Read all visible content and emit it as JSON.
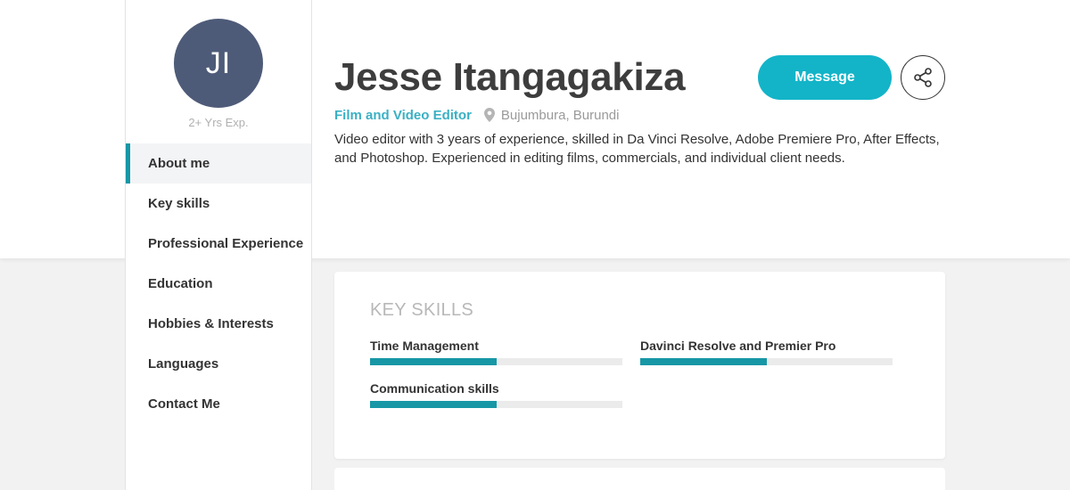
{
  "profile": {
    "initials": "JI",
    "experience": "2+ Yrs Exp.",
    "name": "Jesse Itangagakiza",
    "role": "Film and Video Editor",
    "location": "Bujumbura, Burundi",
    "bio": "Video editor with 3 years of experience, skilled in Da Vinci Resolve, Adobe Premiere Pro, After Effects, and Photoshop. Experienced in editing films, commercials, and individual client needs."
  },
  "actions": {
    "message_label": "Message",
    "share_icon": "share-icon"
  },
  "nav": {
    "active_index": 0,
    "items": [
      {
        "label": "About me"
      },
      {
        "label": "Key skills"
      },
      {
        "label": "Professional Experience"
      },
      {
        "label": "Education"
      },
      {
        "label": "Hobbies & Interests"
      },
      {
        "label": "Languages"
      },
      {
        "label": "Contact Me"
      }
    ]
  },
  "key_skills": {
    "title": "KEY SKILLS",
    "skills": [
      {
        "name": "Time Management",
        "level": 0.5
      },
      {
        "name": "Davinci Resolve and Premier Pro",
        "level": 0.5
      },
      {
        "name": "Communication skills",
        "level": 0.5
      }
    ]
  },
  "colors": {
    "accent": "#13b4c8",
    "accent_dark": "#1797a6",
    "role_text": "#3ab0c4",
    "avatar_bg": "#4e5b78"
  }
}
